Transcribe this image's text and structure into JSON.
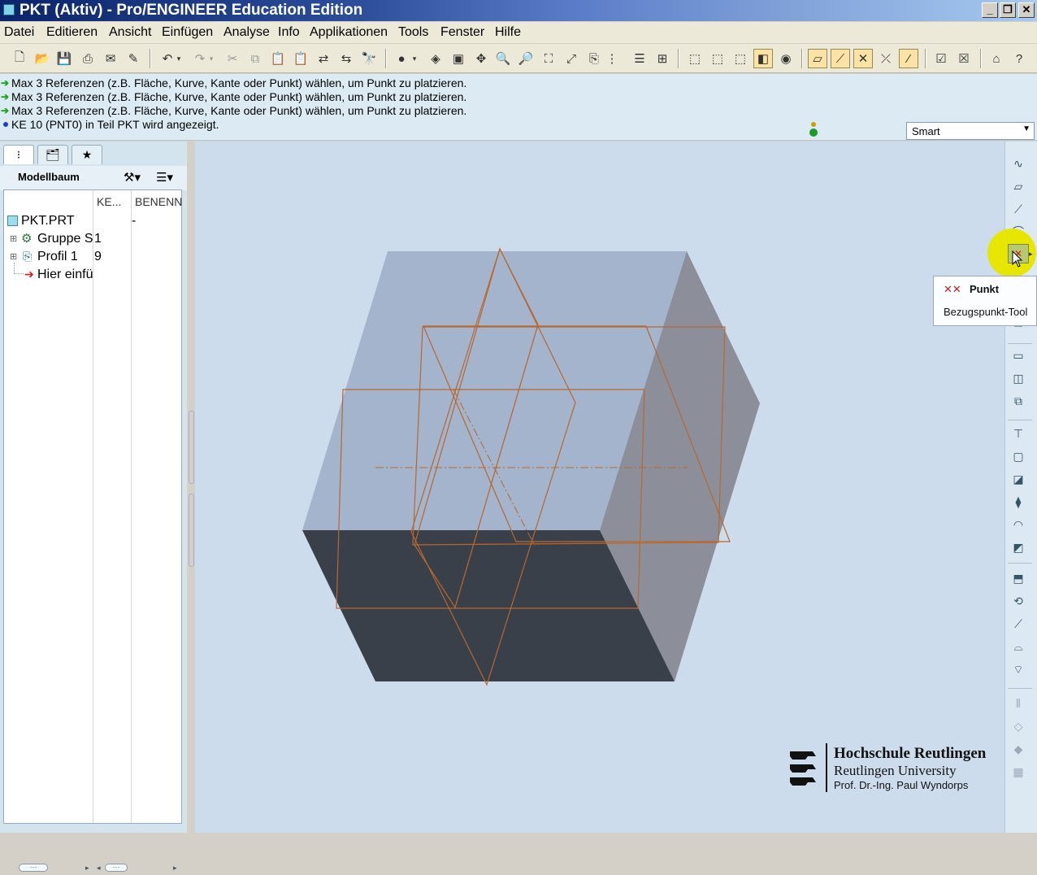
{
  "window": {
    "title": "PKT (Aktiv) - Pro/ENGINEER Education Edition",
    "min_label": "_",
    "max_label": "❐",
    "close_label": "✕"
  },
  "menu": [
    "Datei",
    "Editieren",
    "Ansicht",
    "Einfügen",
    "Analyse",
    "Info",
    "Applikationen",
    "Tools",
    "Fenster",
    "Hilfe"
  ],
  "messages": [
    "Max 3 Referenzen (z.B. Fläche, Kurve, Kante oder Punkt) wählen, um Punkt zu platzieren.",
    "Max 3 Referenzen (z.B. Fläche, Kurve, Kante oder Punkt) wählen, um Punkt zu platzieren.",
    "Max 3 Referenzen (z.B. Fläche, Kurve, Kante oder Punkt) wählen, um Punkt zu platzieren.",
    "KE 10 (PNT0) in Teil PKT wird angezeigt."
  ],
  "filter": {
    "value": "Smart"
  },
  "model_tree": {
    "title": "Modellbaum",
    "columns": [
      "KE...",
      "BENENN"
    ],
    "rows": [
      {
        "name": "PKT.PRT",
        "ke": "-"
      },
      {
        "name": "Gruppe S",
        "ke": "1"
      },
      {
        "name": "Profil 1",
        "ke": "9"
      },
      {
        "name": "Hier einfü",
        "ke": ""
      }
    ]
  },
  "tooltip": {
    "title": "Punkt",
    "text": "Bezugspunkt-Tool"
  },
  "logo": {
    "line1": "Hochschule Reutlingen",
    "line2": "Reutlingen University",
    "line3": "Prof. Dr.-Ing. Paul Wyndorps"
  },
  "colors": {
    "datum_lines": "#b8672f",
    "box_light": "#a3b4cc",
    "box_side": "#8c8f99",
    "box_dark": "#3a404a",
    "background": "#cddcec"
  }
}
